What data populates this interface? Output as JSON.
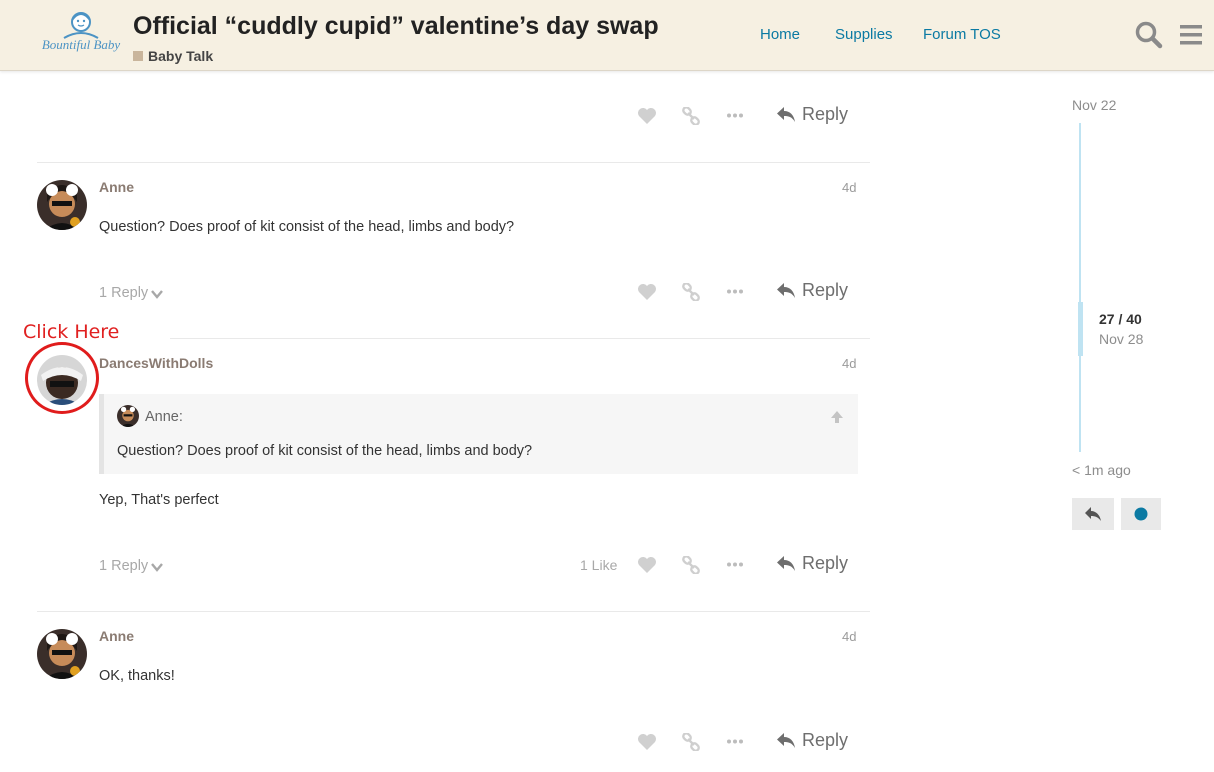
{
  "header": {
    "logo_text": "Bountiful Baby",
    "title": "Official “cuddly cupid” valentine’s day swap",
    "category": "Baby Talk",
    "category_color": "#c9b59c",
    "nav": [
      "Home",
      "Supplies",
      "Forum TOS"
    ],
    "icons": [
      "search-icon",
      "hamburger-menu-icon"
    ]
  },
  "actions": {
    "reply_label": "Reply",
    "icons": [
      "heart-icon",
      "link-icon",
      "ellipsis-icon",
      "reply-arrow-icon"
    ]
  },
  "posts": [
    {
      "author": "Anne",
      "date": "4d",
      "body": "Question? Does proof of kit consist of the head, limbs and body?",
      "replies": "1 Reply"
    },
    {
      "author": "DancesWithDolls",
      "date": "4d",
      "quote": {
        "author": "Anne:",
        "text": "Question? Does proof of kit consist of the head, limbs and body?"
      },
      "body": "Yep, That's perfect",
      "replies": "1 Reply",
      "likes": "1 Like"
    },
    {
      "author": "Anne",
      "date": "4d",
      "body": "OK, thanks!"
    }
  ],
  "annotation": {
    "text": "Click Here",
    "color": "#e02020"
  },
  "timeline": {
    "start_date": "Nov 22",
    "position": "27 / 40",
    "current_date": "Nov 28",
    "end_label": "< 1m ago",
    "accent_color": "#0b7aa3"
  }
}
